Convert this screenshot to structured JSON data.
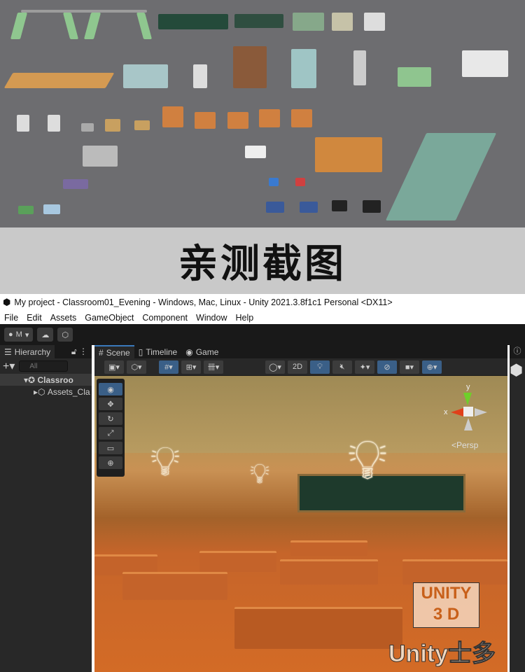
{
  "banner": {
    "text": "亲测截图"
  },
  "window": {
    "title": "My project - Classroom01_Evening - Windows, Mac, Linux - Unity 2021.3.8f1c1 Personal <DX11>"
  },
  "menu": [
    "File",
    "Edit",
    "Assets",
    "GameObject",
    "Component",
    "Window",
    "Help"
  ],
  "toolbar": {
    "account": "M"
  },
  "hierarchy": {
    "tab": "Hierarchy",
    "search_placeholder": "All",
    "items": [
      "Classroo",
      "Assets_Cla"
    ]
  },
  "scene": {
    "tabs": [
      "Scene",
      "Timeline",
      "Game"
    ],
    "btn_2d": "2D",
    "persp": "<Persp",
    "axis_x": "x",
    "axis_y": "y"
  },
  "watermark": {
    "line1": "UNITY",
    "line2": "3 D",
    "line3": "Unity士多"
  }
}
